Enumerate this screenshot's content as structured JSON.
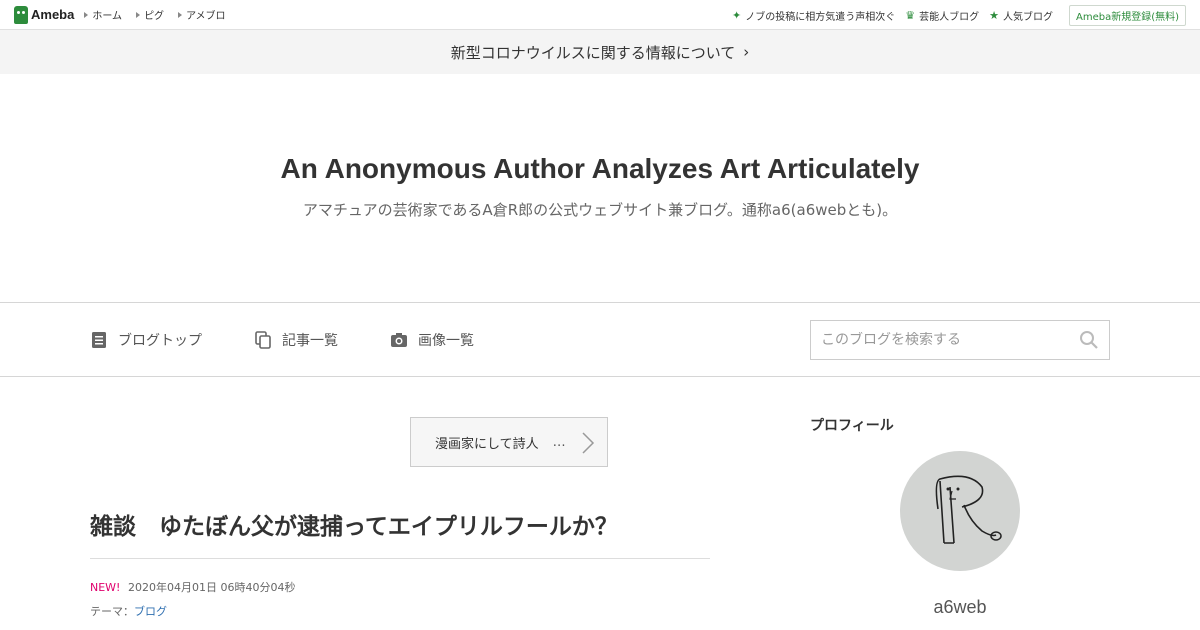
{
  "topbar": {
    "logo_text": "Ameba",
    "links": [
      "ホーム",
      "ピグ",
      "アメブロ"
    ],
    "right_links": [
      {
        "label": "ノブの投稿に相方気遣う声相次ぐ",
        "icon": "sparkle-icon"
      },
      {
        "label": "芸能人ブログ",
        "icon": "crown-icon"
      },
      {
        "label": "人気ブログ",
        "icon": "star-icon"
      }
    ],
    "register": "Ameba新規登録(無料)"
  },
  "notice": {
    "text": "新型コロナウイルスに関する情報について",
    "chevron": "›"
  },
  "header": {
    "title": "An Anonymous Author Analyzes Art Articulately",
    "description": "アマチュアの芸術家であるA倉R郎の公式ウェブサイト兼ブログ。通称a6(a6webとも)。"
  },
  "nav": {
    "items": [
      {
        "label": "ブログトップ",
        "icon": "document-icon"
      },
      {
        "label": "記事一覧",
        "icon": "copy-icon"
      },
      {
        "label": "画像一覧",
        "icon": "camera-icon"
      }
    ],
    "search_placeholder": "このブログを検索する"
  },
  "main": {
    "theme_box": {
      "label": "漫画家にして詩人",
      "more": "…"
    },
    "entry_title": "雑談　ゆたぼん父が逮捕ってエイプリルフールか？",
    "new_badge": "NEW!",
    "datetime": "2020年04月01日 06時40分04秒",
    "theme_label": "テーマ：",
    "theme_value": "ブログ"
  },
  "sidebar": {
    "profile_heading": "プロフィール",
    "username": "a6web"
  },
  "colors": {
    "brand_green": "#2d8c3c",
    "new_pink": "#e0006d",
    "link_blue": "#2f6fb0"
  }
}
